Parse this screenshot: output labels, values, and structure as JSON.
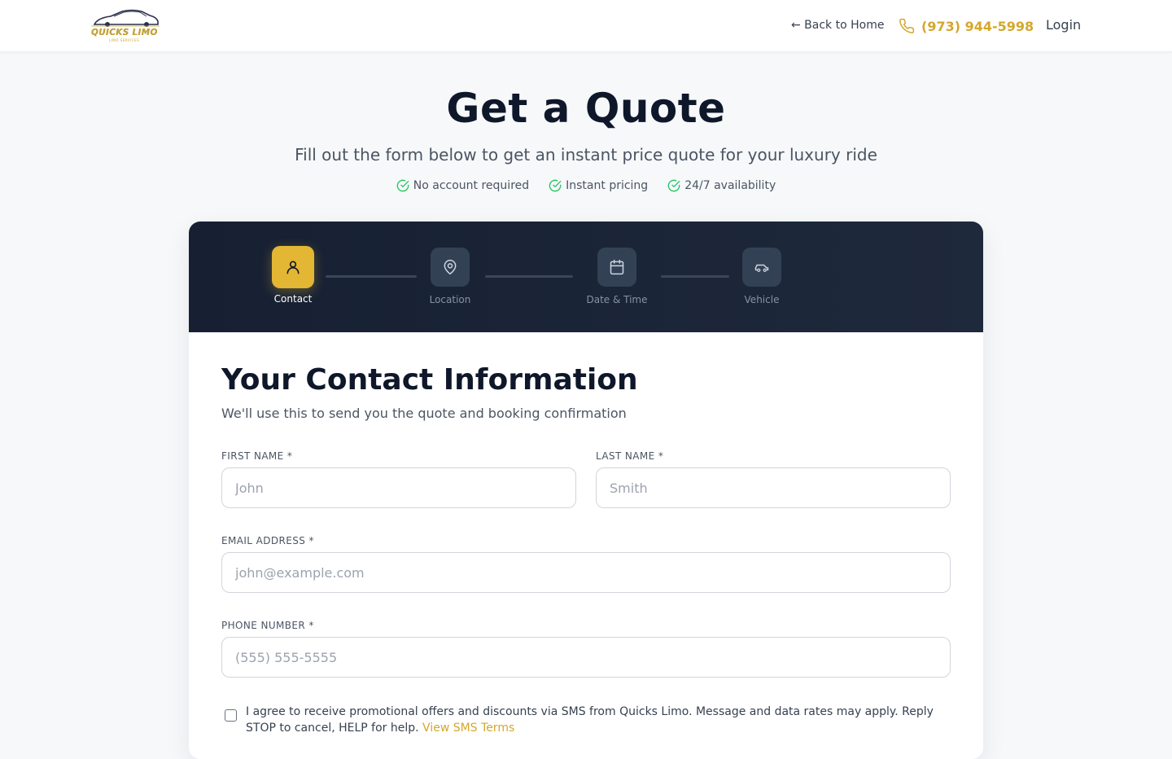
{
  "header": {
    "logo_text": "QUICKS LIMO",
    "logo_sub": "LIMO SERVICES",
    "back_link": "← Back to Home",
    "phone": "(973) 944-5998",
    "login": "Login"
  },
  "hero": {
    "title": "Get a Quote",
    "subtitle": "Fill out the form below to get an instant price quote for your luxury ride",
    "features": [
      "No account required",
      "Instant pricing",
      "24/7 availability"
    ]
  },
  "steps": [
    {
      "label": "Contact",
      "icon": "user-icon",
      "active": true
    },
    {
      "label": "Location",
      "icon": "map-pin-icon",
      "active": false
    },
    {
      "label": "Date & Time",
      "icon": "calendar-icon",
      "active": false
    },
    {
      "label": "Vehicle",
      "icon": "car-icon",
      "active": false
    }
  ],
  "form": {
    "title": "Your Contact Information",
    "subtitle": "We'll use this to send you the quote and booking confirmation",
    "first_name": {
      "label": "FIRST NAME *",
      "placeholder": "John",
      "value": ""
    },
    "last_name": {
      "label": "LAST NAME *",
      "placeholder": "Smith",
      "value": ""
    },
    "email": {
      "label": "EMAIL ADDRESS *",
      "placeholder": "john@example.com",
      "value": ""
    },
    "phone": {
      "label": "PHONE NUMBER *",
      "placeholder": "(555) 555-5555",
      "value": ""
    },
    "consent_text": "I agree to receive promotional offers and discounts via SMS from Quicks Limo. Message and data rates may apply. Reply STOP to cancel, HELP for help.",
    "consent_link": "View SMS Terms",
    "consent_checked": false
  },
  "colors": {
    "accent": "#e3b633",
    "accent_text": "#d4a72c",
    "stepper_bg": "#1e293b",
    "check_green": "#22c55e"
  }
}
